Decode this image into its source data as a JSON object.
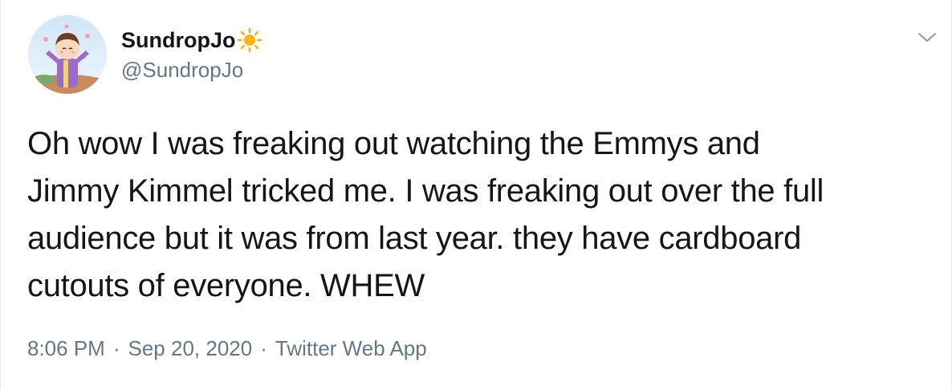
{
  "tweet": {
    "display_name": "SundropJo",
    "handle": "@SundropJo",
    "text": "Oh wow I was freaking out watching the Emmys and\nJimmy Kimmel tricked me. I was freaking out over the full\naudience but it was from last year. they have cardboard\ncutouts of everyone. WHEW",
    "time": "8:06 PM",
    "date": "Sep 20, 2020",
    "source": "Twitter Web App",
    "separator": "·"
  },
  "icons": {
    "name_emoji": "sun-icon",
    "menu": "chevron-down-icon"
  },
  "colors": {
    "text": "#14171a",
    "secondary": "#657786",
    "sun": "#f9b416",
    "border": "#e6ecf0"
  }
}
